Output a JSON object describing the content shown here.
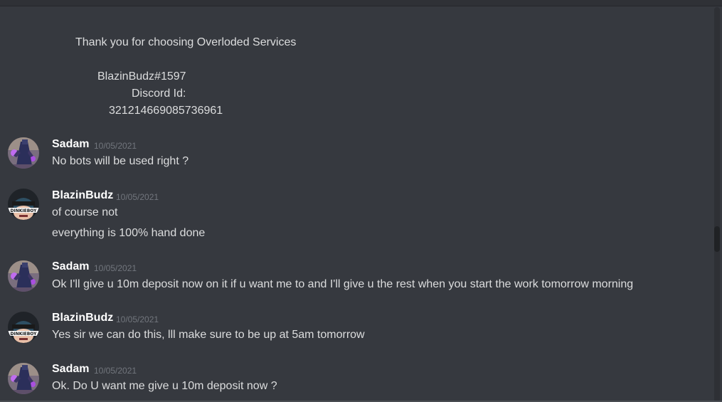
{
  "header_lines": [
    "Thank you for choosing Overloded Services",
    "BlazinBudz#1597",
    "Discord Id:",
    "321214669085736961"
  ],
  "messages": [
    {
      "author": "Sadam",
      "timestamp": "10/05/2021",
      "avatar": "purple-character-avatar",
      "lines": [
        "No bots will be used right ?"
      ]
    },
    {
      "author": "BlazinBudz",
      "timestamp": "10/05/2021",
      "avatar": "cartoon-face-avatar",
      "lines": [
        "of course not",
        "everything is 100% hand done"
      ]
    },
    {
      "author": "Sadam",
      "timestamp": "10/05/2021",
      "avatar": "purple-character-avatar",
      "lines": [
        "Ok I'll give u 10m deposit now on it if u want me to and I'll give u the rest when you start the work tomorrow morning"
      ]
    },
    {
      "author": "BlazinBudz",
      "timestamp": "10/05/2021",
      "avatar": "cartoon-face-avatar",
      "lines": [
        "Yes sir we can do this, lll make sure to be up at 5am tomorrow"
      ]
    },
    {
      "author": "Sadam",
      "timestamp": "10/05/2021",
      "avatar": "purple-character-avatar",
      "lines": [
        "Ok. Do U want me give u 10m deposit now ?"
      ]
    }
  ],
  "avatar_text": "DINKIEBOY",
  "colors": {
    "background": "#36393f",
    "text": "#dcddde",
    "username": "#ffffff",
    "timestamp": "#72767d"
  }
}
